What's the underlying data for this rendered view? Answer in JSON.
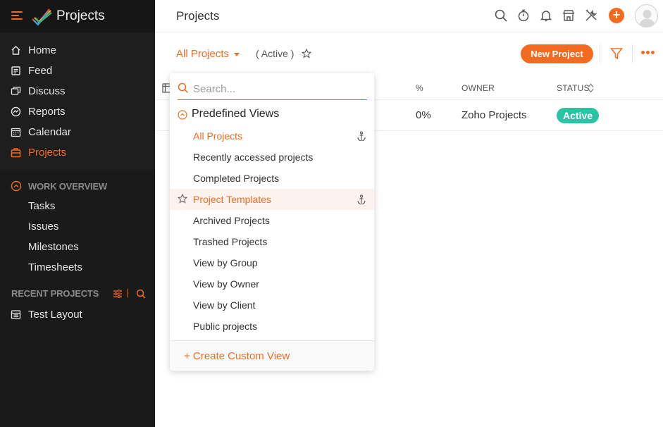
{
  "app": {
    "title": "Projects"
  },
  "sidebar": {
    "nav": [
      {
        "label": "Home",
        "icon": "home-icon"
      },
      {
        "label": "Feed",
        "icon": "feed-icon"
      },
      {
        "label": "Discuss",
        "icon": "discuss-icon"
      },
      {
        "label": "Reports",
        "icon": "reports-icon"
      },
      {
        "label": "Calendar",
        "icon": "calendar-icon"
      },
      {
        "label": "Projects",
        "icon": "projects-icon",
        "active": true
      }
    ],
    "work_overview": {
      "title": "WORK OVERVIEW",
      "items": [
        {
          "label": "Tasks"
        },
        {
          "label": "Issues"
        },
        {
          "label": "Milestones"
        },
        {
          "label": "Timesheets"
        }
      ]
    },
    "recent": {
      "title": "RECENT PROJECTS",
      "items": [
        {
          "label": "Test Layout"
        }
      ]
    }
  },
  "header": {
    "title": "Projects"
  },
  "subheader": {
    "view_label": "All Projects",
    "filter_label": "( Active )",
    "new_project_label": "New Project"
  },
  "table": {
    "columns": [
      {
        "label": "%"
      },
      {
        "label": "OWNER"
      },
      {
        "label": "STATUS"
      }
    ],
    "rows": [
      {
        "percent": "0%",
        "owner": "Zoho Projects",
        "status": "Active"
      }
    ]
  },
  "dropdown": {
    "search_placeholder": "Search...",
    "group_label": "Predefined Views",
    "items": [
      {
        "label": "All Projects",
        "selected": true
      },
      {
        "label": "Recently accessed projects"
      },
      {
        "label": "Completed Projects"
      },
      {
        "label": "Project Templates",
        "hovered": true
      },
      {
        "label": "Archived Projects"
      },
      {
        "label": "Trashed Projects"
      },
      {
        "label": "View by Group"
      },
      {
        "label": "View by Owner"
      },
      {
        "label": "View by Client"
      },
      {
        "label": "Public projects"
      }
    ],
    "footer_label": "+ Create Custom View"
  },
  "colors": {
    "accent": "#f26b21",
    "sidebar_bg": "#1e1e1e",
    "status_active": "#2cc3a5"
  }
}
